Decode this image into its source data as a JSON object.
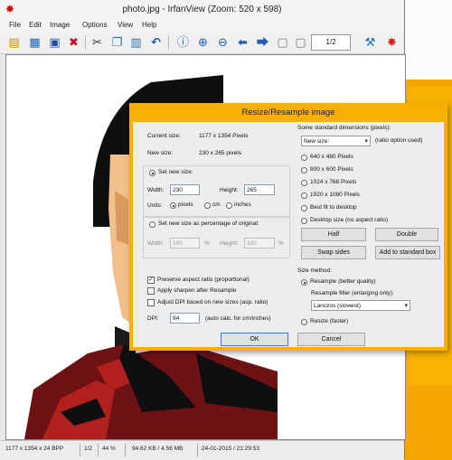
{
  "window": {
    "title": "photo.jpg - IrfanView (Zoom: 520 x 598)",
    "menu": [
      "File",
      "Edit",
      "Image",
      "Options",
      "View",
      "Help"
    ],
    "page_indicator": "1/2"
  },
  "toolbar_icons": [
    "open-icon",
    "thumbnails-icon",
    "save-icon",
    "delete-icon",
    "cut-icon",
    "copy-icon",
    "paste-icon",
    "undo-icon",
    "info-icon",
    "zoom-in-icon",
    "zoom-out-icon",
    "previous-icon",
    "next-icon",
    "previous-page-icon",
    "next-page-icon",
    "settings-icon",
    "irfanview-icon"
  ],
  "status": {
    "dimensions": "1177 x 1354 x 24 BPP",
    "page": "1/2",
    "zoom": "44 %",
    "filesize": "94.62 KB / 4.56 MB",
    "datetime": "24-01-2015 / 21:29:53"
  },
  "dialog": {
    "title": "Resize/Resample image",
    "current_size_label": "Current size:",
    "current_size_value": "1177  x  1354  Pixels",
    "new_size_label": "New size:",
    "new_size_value": "230  x  265  pixels",
    "set_new_size": "Set new size:",
    "width_label": "Width:",
    "width_value": "230",
    "height_label": "Height:",
    "height_value": "265",
    "units_label": "Units:",
    "unit_pixels": "pixels",
    "unit_cm": "cm",
    "unit_inches": "inches",
    "set_percentage": "Set new size as percentage of original:",
    "pct_width_label": "Width:",
    "pct_width_value": "100",
    "pct_height_label": "Height:",
    "pct_height_value": "100",
    "pct_sign": "%",
    "preserve_aspect": "Preserve aspect ratio (proportional)",
    "apply_sharpen": "Apply sharpen after Resample",
    "adjust_dpi": "Adjust DPI based on new sizes (asp. ratio)",
    "dpi_label": "DPI:",
    "dpi_value": "94",
    "dpi_note": "(auto calc. for cm/inches)",
    "std_dims_label": "Some standard dimensions (pixels):",
    "std_select_value": "New size:",
    "ratio_note": "(ratio option used)",
    "std_options": [
      "640 x 480 Pixels",
      "800 x 600 Pixels",
      "1024 x 768 Pixels",
      "1920 x 1080 Pixels",
      "Best fit to desktop",
      "Desktop size (no aspect ratio)"
    ],
    "half": "Half",
    "double": "Double",
    "swap_sides": "Swap sides",
    "add_standard": "Add to standard box",
    "size_method": "Size method:",
    "resample": "Resample (better quality)",
    "resample_filter_label": "Resample filter (enlarging only):",
    "filter_value": "Lanczos (slowest)",
    "resize_faster": "Resize (faster)",
    "ok": "OK",
    "cancel": "Cancel"
  },
  "colors": {
    "accent": "#f7b000",
    "image_dark": "#0f0f0f",
    "image_skin": "#f1c08d",
    "image_maroon": "#6e1216",
    "image_red": "#b0201d"
  }
}
